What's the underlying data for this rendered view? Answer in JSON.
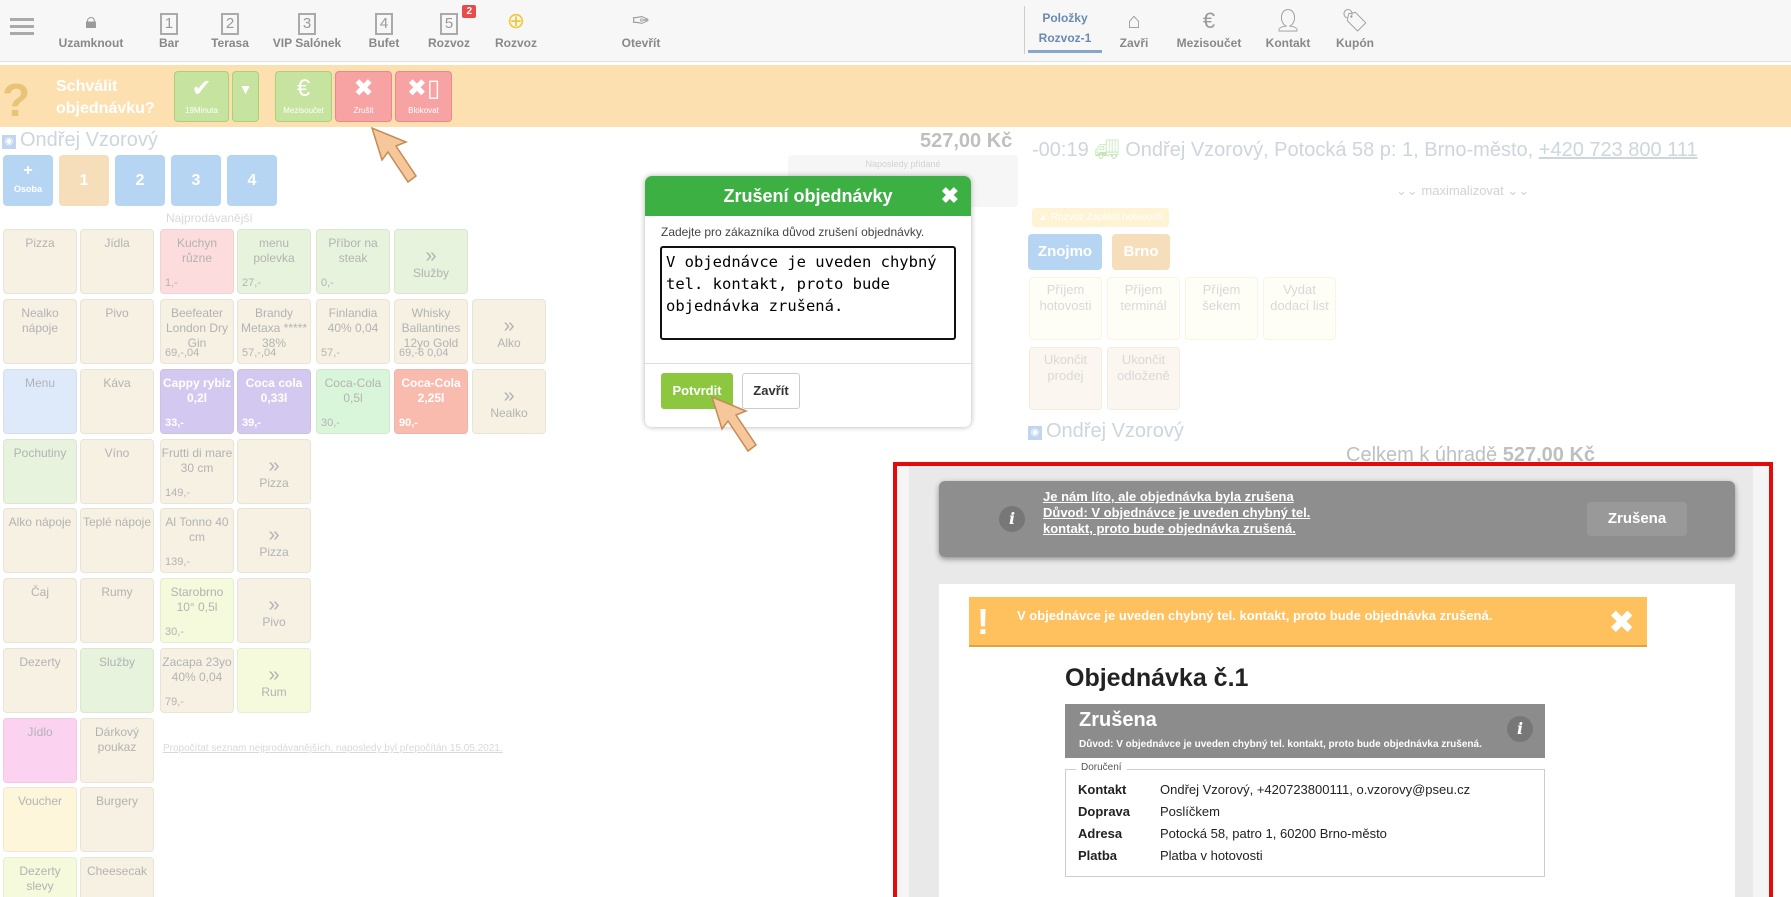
{
  "topbar": {
    "items": [
      {
        "label": "Uzamknout",
        "icon": "lock-icon"
      },
      {
        "label": "Bar",
        "num": "1"
      },
      {
        "label": "Terasa",
        "num": "2"
      },
      {
        "label": "VIP Salónek",
        "num": "3"
      },
      {
        "label": "Bufet",
        "num": "4"
      },
      {
        "label": "Rozvoz",
        "num": "5",
        "badge": "2"
      },
      {
        "label": "Rozvoz",
        "icon": "plus-circle-icon"
      },
      {
        "label": "Otevřít",
        "icon": "open-icon"
      }
    ],
    "right_tab": {
      "line1": "Položky",
      "line2": "Rozvoz-1"
    },
    "right_items": [
      {
        "label": "Zavři",
        "icon": "home-icon"
      },
      {
        "label": "Mezisoučet",
        "icon": "euro-icon"
      },
      {
        "label": "Kontakt",
        "icon": "user-icon"
      },
      {
        "label": "Kupón",
        "icon": "coupon-icon"
      }
    ]
  },
  "approve": {
    "qmark": "?",
    "line1": "Schválit",
    "line2": "objednávku?",
    "btn_time": "19Minuta",
    "btn_subtotal": "Mezisoučet",
    "btn_cancel": "Zrušit",
    "btn_block": "Blokovat"
  },
  "left": {
    "customer": "Ondřej Vzorový",
    "add_person": "Osoba",
    "seats": [
      "1",
      "2",
      "3",
      "4"
    ],
    "bestsellers": "Najprodávanější",
    "total": "527,00 Kč",
    "last_added": "Naposledy přidané",
    "recalc": "Propočítat seznam nejprodávanějších, naposledy byl přepočítán 15.05.2021."
  },
  "tiles": [
    {
      "label": "Pizza",
      "price": ""
    },
    {
      "label": "Jídla",
      "price": ""
    },
    {
      "label": "Kuchyn různe",
      "price": "1,-"
    },
    {
      "label": "menu polevka",
      "price": "27,-"
    },
    {
      "label": "Příbor na steak",
      "price": "0,-"
    },
    {
      "label": "Služby",
      "price": ""
    },
    {
      "label": "Nealko nápoje",
      "price": ""
    },
    {
      "label": "Pivo",
      "price": ""
    },
    {
      "label": "Beefeater London Dry Gin",
      "price": "69,-,04"
    },
    {
      "label": "Brandy Metaxa ***** 38%",
      "price": "57,-,04"
    },
    {
      "label": "Finlandia 40% 0,04",
      "price": "57,-"
    },
    {
      "label": "Whisky Ballantines 12yo Gold",
      "price": "69,-6 0,04"
    },
    {
      "label": "Alko",
      "price": ""
    },
    {
      "label": "Menu",
      "price": ""
    },
    {
      "label": "Káva",
      "price": ""
    },
    {
      "label": "Cappy rybíz 0,2l",
      "price": "33,-"
    },
    {
      "label": "Coca cola 0,33l",
      "price": "39,-"
    },
    {
      "label": "Coca-Cola 0,5l",
      "price": "30,-"
    },
    {
      "label": "Coca-Cola 2,25l",
      "price": "90,-"
    },
    {
      "label": "Nealko",
      "price": ""
    },
    {
      "label": "Pochutiny",
      "price": ""
    },
    {
      "label": "Víno",
      "price": ""
    },
    {
      "label": "Frutti di mare 30 cm",
      "price": "149,-"
    },
    {
      "label": "Pizza",
      "price": ""
    },
    {
      "label": "Alko nápoje",
      "price": ""
    },
    {
      "label": "Teplé nápoje",
      "price": ""
    },
    {
      "label": "Al Tonno 40 cm",
      "price": "139,-"
    },
    {
      "label": "Pizza",
      "price": ""
    },
    {
      "label": "Čaj",
      "price": ""
    },
    {
      "label": "Rumy",
      "price": ""
    },
    {
      "label": "Starobrno 10° 0,5l",
      "price": "30,-"
    },
    {
      "label": "Pivo",
      "price": ""
    },
    {
      "label": "Dezerty",
      "price": ""
    },
    {
      "label": "Služby",
      "price": ""
    },
    {
      "label": "Zacapa 23yo 40% 0,04",
      "price": "79,-"
    },
    {
      "label": "Rum",
      "price": ""
    },
    {
      "label": "Jídlo",
      "price": ""
    },
    {
      "label": "Dárkový poukaz",
      "price": ""
    },
    {
      "label": "Voucher",
      "price": ""
    },
    {
      "label": "Burgery",
      "price": ""
    },
    {
      "label": "Dezerty slevy",
      "price": ""
    },
    {
      "label": "Cheesecak",
      "price": ""
    }
  ],
  "right": {
    "order_time": "-00:19",
    "order_address": "Ondřej Vzorový, Potocká 58 p: 1, Brno-město,",
    "order_phone": "+420 723 800 111",
    "maximize": "maximalizovat",
    "delivery_tag": "Rozvoz Zaplatit hotovostí",
    "locations": [
      "Znojmo",
      "Brno"
    ],
    "payments": [
      "Příjem hotovosti",
      "Příjem terminál",
      "Příjem šekem",
      "Vydat dodací list",
      "Ukončit prodej",
      "Ukončit odloženě"
    ],
    "customer": "Ondřej Vzorový",
    "total_label": "Celkem k úhradě",
    "total_value": "527,00 Kč"
  },
  "modal": {
    "title": "Zrušení objednávky",
    "description": "Zadejte pro zákazníka důvod zrušení objednávky.",
    "reason": "V objednávce je uveden chybný tel. kontakt, proto bude objednávka zrušená.",
    "confirm": "Potvrdit",
    "close": "Zavřít"
  },
  "preview": {
    "banner_text": "Je nám líto, ale objednávka byla zrušena Důvod: V objednávce je uveden chybný tel. kontakt, proto bude objednávka zrušená.",
    "banner_status": "Zrušena",
    "warning": "V objednávce je uveden chybný tel. kontakt, proto bude objednávka zrušená.",
    "order_title": "Objednávka č.1",
    "status_title": "Zrušena",
    "status_reason": "Důvod: V objednávce je uveden chybný tel. kontakt, proto bude objednávka zrušená.",
    "delivery_legend": "Doručení",
    "rows": [
      {
        "key": "Kontakt",
        "value": "Ondřej Vzorový, +420723800111, o.vzorovy@pseu.cz"
      },
      {
        "key": "Doprava",
        "value": "Poslíčkem"
      },
      {
        "key": "Adresa",
        "value": "Potocká 58, patro 1, 60200 Brno-město"
      },
      {
        "key": "Platba",
        "value": "Platba v hotovosti"
      }
    ]
  },
  "colors": {
    "green_header": "#3cb043",
    "confirm_green": "#8dc63f",
    "highlight_red": "#e20a0a",
    "approve_bar": "#fde0b0"
  }
}
